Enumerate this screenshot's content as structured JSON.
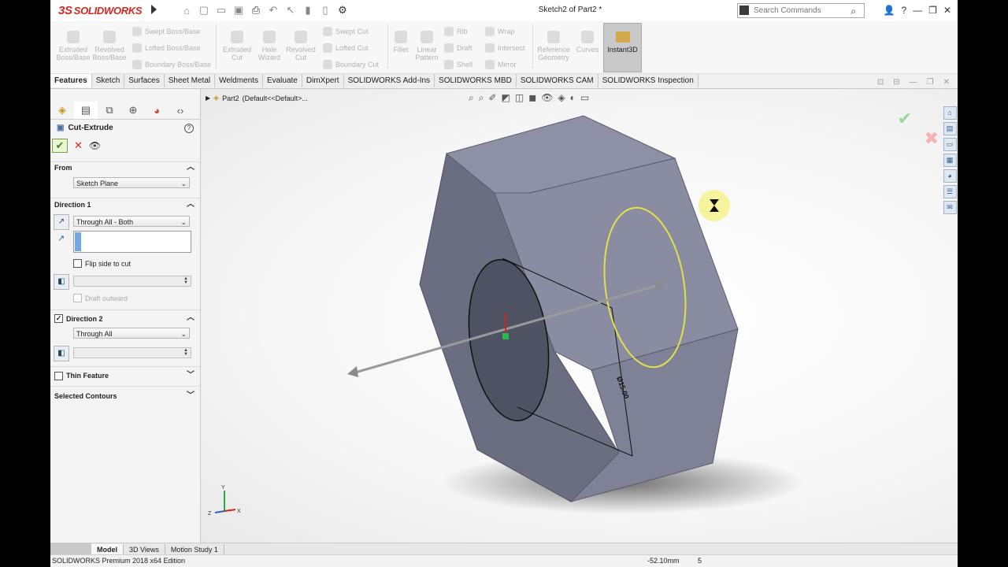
{
  "window": {
    "title": "Sketch2 of Part2 *",
    "brand": "SOLIDWORKS",
    "search_placeholder": "Search Commands"
  },
  "command_manager": {
    "extrude_boss": "Extruded Boss/Base",
    "revolve_boss": "Revolved Boss/Base",
    "swept_boss": "Swept Boss/Base",
    "lofted_boss": "Lofted Boss/Base",
    "boundary_boss": "Boundary Boss/Base",
    "extruded_cut": "Extruded Cut",
    "hole_wizard": "Hole Wizard",
    "revolved_cut": "Revolved Cut",
    "swept_cut": "Swept Cut",
    "lofted_cut": "Lofted Cut",
    "boundary_cut": "Boundary Cut",
    "fillet": "Fillet",
    "linear_pattern": "Linear Pattern",
    "rib": "Rib",
    "draft": "Draft",
    "shell": "Shell",
    "wrap": "Wrap",
    "intersect": "Intersect",
    "mirror": "Mirror",
    "reference_geometry": "Reference Geometry",
    "curves": "Curves",
    "instant3d": "Instant3D"
  },
  "tabs": [
    "Features",
    "Sketch",
    "Surfaces",
    "Sheet Metal",
    "Weldments",
    "Evaluate",
    "DimXpert",
    "SOLIDWORKS Add-Ins",
    "SOLIDWORKS MBD",
    "SOLIDWORKS CAM",
    "SOLIDWORKS Inspection"
  ],
  "property_manager": {
    "title": "Cut-Extrude",
    "from_label": "From",
    "from_value": "Sketch Plane",
    "direction1_label": "Direction 1",
    "direction1_value": "Through All - Both",
    "flip_side": "Flip side to cut",
    "draft_outward": "Draft outward",
    "direction2_label": "Direction 2",
    "direction2_value": "Through All",
    "thin_feature": "Thin Feature",
    "selected_contours": "Selected Contours"
  },
  "viewport": {
    "breadcrumb_part": "Part2",
    "breadcrumb_config": "(Default<<Default>...",
    "dimension": "Ø15.00",
    "axis_x": "X",
    "axis_y": "Y",
    "axis_z": "Z"
  },
  "bottom_tabs": [
    "Model",
    "3D Views",
    "Motion Study 1"
  ],
  "status": {
    "edition": "SOLIDWORKS Premium 2018 x64 Edition",
    "coord": "-52.10mm",
    "value": "5"
  },
  "colors": {
    "brand_red": "#d7261e",
    "body_face_light": "#8c8fa5",
    "body_face_dark": "#6d7082",
    "sketch_yellow": "#e3e04a"
  }
}
